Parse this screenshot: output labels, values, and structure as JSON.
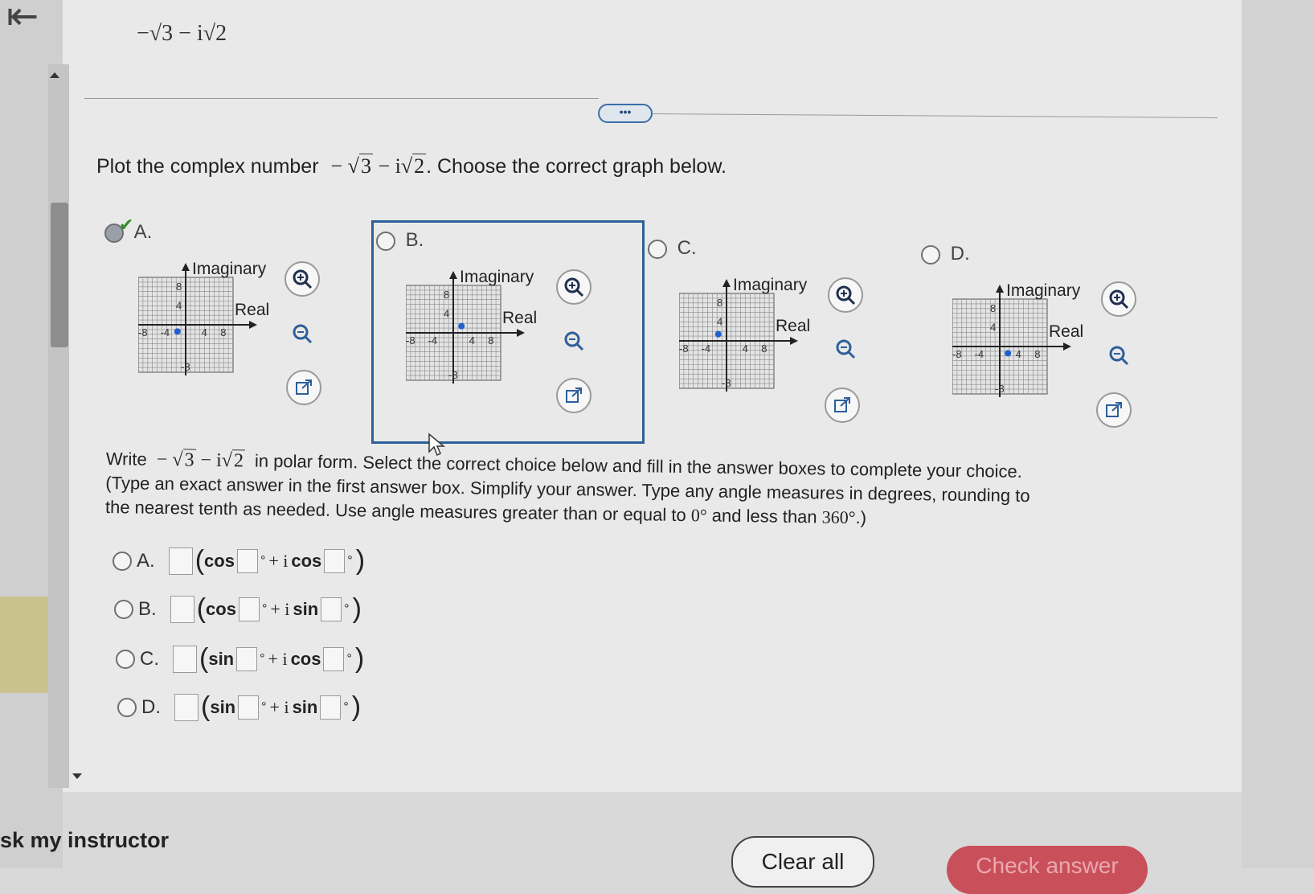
{
  "header": {
    "expression": "−√3 − i√2"
  },
  "toolbar": {
    "more_label": "•••"
  },
  "question_1": {
    "prefix": "Plot the complex number",
    "expression_neg": "−",
    "sqrt_a": "3",
    "minus_i": "− i",
    "sqrt_b": "2",
    "suffix": ". Choose the correct graph below."
  },
  "graph_options": [
    {
      "letter": "A.",
      "selected": true,
      "point": [
        -1.73,
        -1.41
      ]
    },
    {
      "letter": "B.",
      "selected": false,
      "point": [
        1.73,
        1.41
      ]
    },
    {
      "letter": "C.",
      "selected": false,
      "point": [
        -1.73,
        1.41
      ]
    },
    {
      "letter": "D.",
      "selected": false,
      "point": [
        1.73,
        -1.41
      ]
    }
  ],
  "graph_labels": {
    "imaginary": "Imaginary",
    "real": "Real",
    "tick_8": "8",
    "tick_4": "4",
    "tick_neg8": "-8",
    "tick_neg4": "-4",
    "tick_neg8_y": "-8"
  },
  "question_2": {
    "write": "Write",
    "expr_neg": "−",
    "sqrt_a": "3",
    "minus_i": "− i",
    "sqrt_b": "2",
    "rest_1": "in polar form. Select the correct choice below and fill in the answer boxes to complete your choice.",
    "rest_2": "(Type an exact answer in the first answer box. Simplify your answer. Type any angle measures in degrees, rounding to",
    "rest_3a": "the nearest tenth as needed. Use angle measures greater than or equal to",
    "zero_deg": "0°",
    "rest_3b": "and less than",
    "deg_360": "360°",
    "rest_3c": ".)"
  },
  "polar_choices": [
    {
      "letter": "A.",
      "f1": "cos",
      "plus": "+ i",
      "f2": "cos"
    },
    {
      "letter": "B.",
      "f1": "cos",
      "plus": "+ i",
      "f2": "sin"
    },
    {
      "letter": "C.",
      "f1": "sin",
      "plus": "+ i",
      "f2": "cos"
    },
    {
      "letter": "D.",
      "f1": "sin",
      "plus": "+ i",
      "f2": "sin"
    }
  ],
  "footer": {
    "ask_instructor": "sk my instructor",
    "clear_all": "Clear all",
    "check_answer": "Check answer"
  },
  "colors": {
    "selected_border": "#2d5f99",
    "point": "#1f5fd0",
    "check_button": "#c9505b"
  }
}
